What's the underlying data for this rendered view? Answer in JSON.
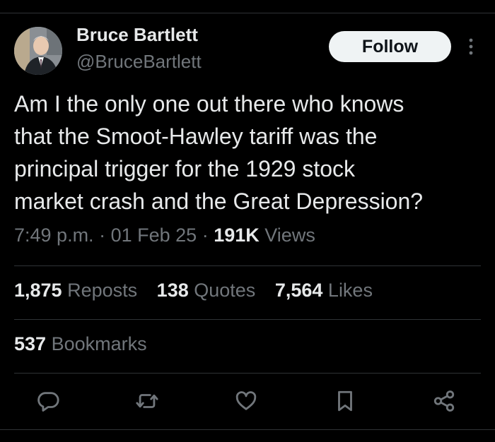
{
  "author": {
    "name": "Bruce Bartlett",
    "handle": "@BruceBartlett",
    "follow_label": "Follow"
  },
  "tweet": {
    "text": "Am I the only one out there who knows\nthat the Smoot-Hawley tariff was the\nprincipal trigger for the 1929 stock\nmarket crash and the Great Depression?",
    "time": "7:49 p.m.",
    "date": "01 Feb 25",
    "views_count": "191K",
    "views_label": "Views",
    "separator": "·"
  },
  "stats": {
    "reposts_count": "1,875",
    "reposts_label": "Reposts",
    "quotes_count": "138",
    "quotes_label": "Quotes",
    "likes_count": "7,564",
    "likes_label": "Likes",
    "bookmarks_count": "537",
    "bookmarks_label": "Bookmarks"
  },
  "actions": {
    "icons": [
      "reply-icon",
      "repost-icon",
      "like-icon",
      "bookmark-icon",
      "share-icon"
    ],
    "icon_color": "#71767b"
  },
  "colors": {
    "background": "#000000",
    "text_primary": "#e7e9ea",
    "text_secondary": "#71767b",
    "divider": "#2f3336",
    "follow_bg": "#eff3f4"
  }
}
